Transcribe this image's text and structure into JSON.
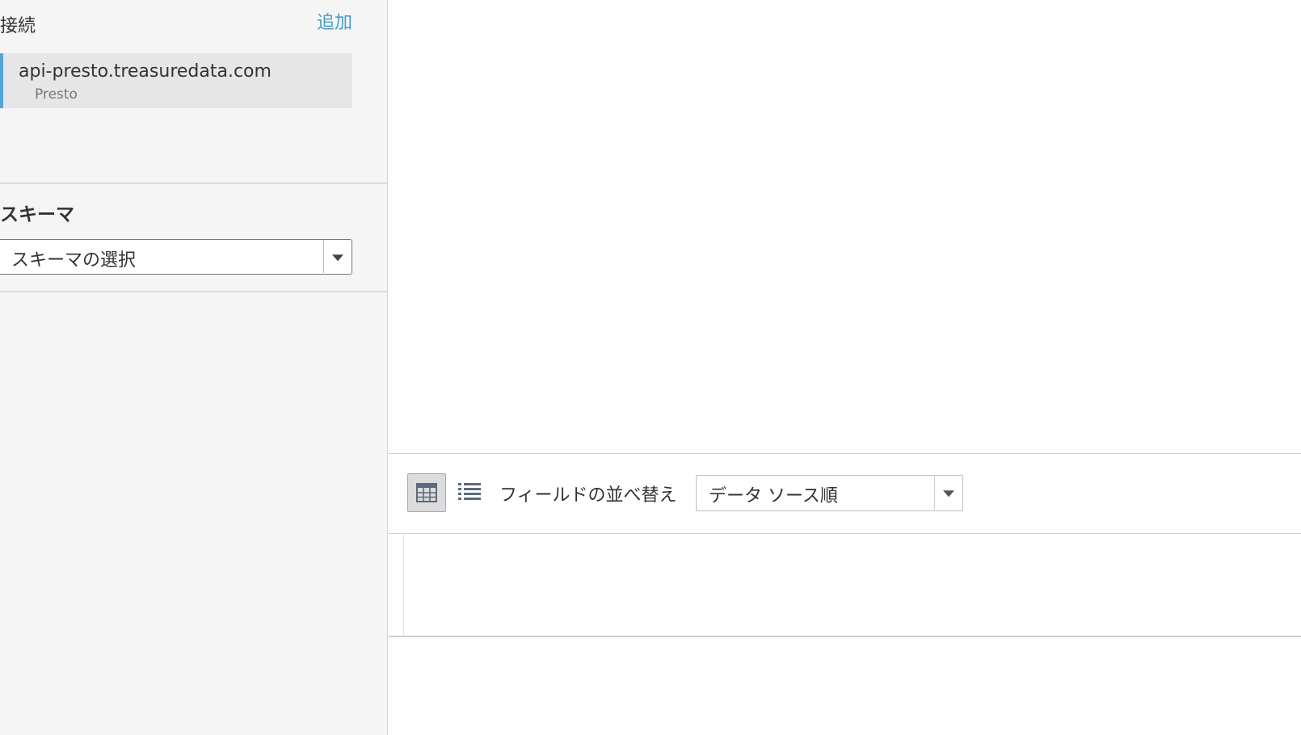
{
  "connections": {
    "title": "接続",
    "add_label": "追加",
    "items": [
      {
        "host": "api-presto.treasuredata.com",
        "type": "Presto"
      }
    ]
  },
  "schema": {
    "title": "スキーマ",
    "select_value": "スキーマの選択"
  },
  "toolbar": {
    "grid_view_icon": "grid-icon",
    "list_view_icon": "list-icon",
    "sort_label": "フィールドの並べ替え",
    "sort_value": "データ ソース順"
  },
  "colors": {
    "accent": "#4a9bc9",
    "selected_bar": "#5ba4cf",
    "sidebar_bg": "#f5f5f5"
  }
}
